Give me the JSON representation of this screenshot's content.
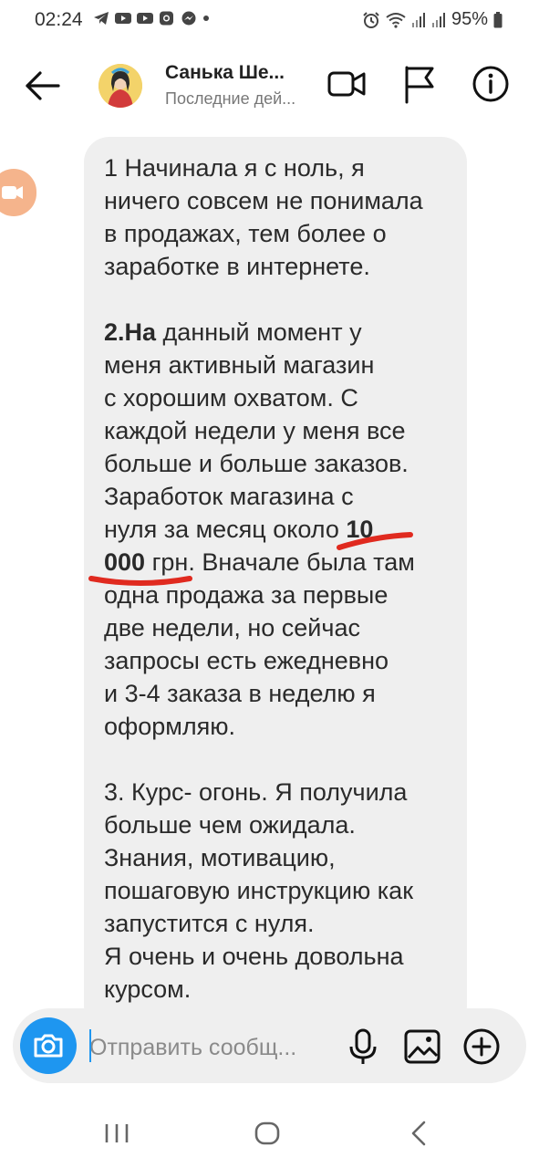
{
  "status_bar": {
    "time": "02:24",
    "battery": "95%",
    "left_icons": [
      "telegram-icon",
      "youtube-icon",
      "youtube-icon",
      "instagram-icon",
      "messenger-icon",
      "dot-icon"
    ],
    "right_icons": [
      "alarm-icon",
      "wifi-icon",
      "signal-icon",
      "signal-icon",
      "battery-icon"
    ]
  },
  "header": {
    "contact_name": "Санька Ше...",
    "contact_status": "Последние дей...",
    "actions": [
      "back-arrow-icon",
      "video-call-icon",
      "flag-icon",
      "info-icon"
    ]
  },
  "message": {
    "paragraph1": "1 Начинала я с ноль, я\nничего совсем не понимала\nв продажах, тем более о\nзаработке в интернете.",
    "p2_bold_start": "2.На",
    "p2_part1": " данный момент у\nменя активный магазин\nс хорошим охватом. С\nкаждой недели у меня все\nбольше и больше заказов.\nЗаработок магазина с\nнуля за месяц около ",
    "p2_bold_amount": "10\n000",
    "p2_part2": " грн. Вначале была там\nодна продажа за первые\nдве недели, но сейчас\nзапросы есть ежедневно\nи 3-4 заказа в неделю я\nоформляю.",
    "paragraph3": "3. Курс- огонь. Я получила\nбольше чем ожидала.\nЗнания, мотивацию,\nпошаговую инструкцию как\nзапустится с нуля.\nЯ очень и очень довольна\nкурсом."
  },
  "composer": {
    "placeholder": "Отправить сообщ...",
    "value": ""
  },
  "colors": {
    "accent": "#1e96f0",
    "bubble": "#efefef",
    "underline": "#e02a1f",
    "call_pill": "#f5b48c"
  },
  "navbar": {
    "buttons": [
      "recents-icon",
      "home-icon",
      "back-icon"
    ]
  }
}
